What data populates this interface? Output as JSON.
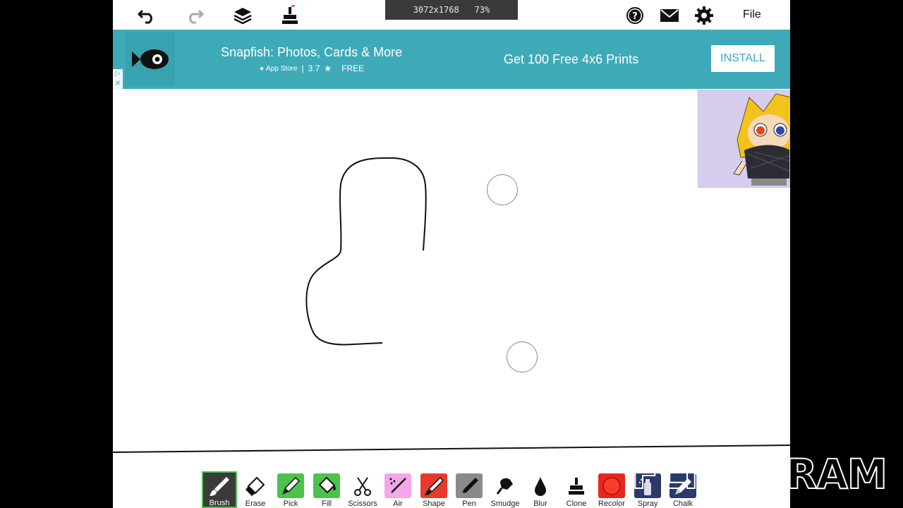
{
  "topbar": {
    "canvas_size": "3072x1768",
    "zoom": "73%",
    "file_label": "File",
    "icons": [
      "undo-icon",
      "redo-icon",
      "layers-icon",
      "stamp-icon",
      "help-icon",
      "mail-icon",
      "gear-icon"
    ]
  },
  "ad": {
    "title": "Snapfish: Photos, Cards & More",
    "store": "App Store",
    "rating": "3.7",
    "price": "FREE",
    "cta_text": "Get 100 Free 4x6 Prints",
    "install_label": "INSTALL",
    "color": "#3eaab8"
  },
  "tools": [
    {
      "id": "brush",
      "label": "Brush",
      "color": "#3a3a3a",
      "active": true
    },
    {
      "id": "erase",
      "label": "Erase",
      "color": "#ffffff"
    },
    {
      "id": "pick",
      "label": "Pick",
      "color": "#4cc24c"
    },
    {
      "id": "fill",
      "label": "Fill",
      "color": "#4cc24c"
    },
    {
      "id": "scissors",
      "label": "Scissors",
      "color": "#ffffff"
    },
    {
      "id": "air",
      "label": "Air",
      "color": "#f4a6e8"
    },
    {
      "id": "shape",
      "label": "Shape",
      "color": "#e83a2a"
    },
    {
      "id": "pen",
      "label": "Pen",
      "color": "#8a8a8a"
    },
    {
      "id": "smudge",
      "label": "Smudge",
      "color": "#ffffff"
    },
    {
      "id": "blur",
      "label": "Blur",
      "color": "#ffffff"
    },
    {
      "id": "clone",
      "label": "Clone",
      "color": "#ffffff"
    },
    {
      "id": "recolor",
      "label": "Recolor",
      "color": "#e8261e"
    },
    {
      "id": "spray",
      "label": "Spray",
      "color": "#2a3a6a"
    },
    {
      "id": "chalk",
      "label": "Chalk",
      "color": "#2a3a6a"
    }
  ],
  "watermark": "FLIPAGRAM"
}
